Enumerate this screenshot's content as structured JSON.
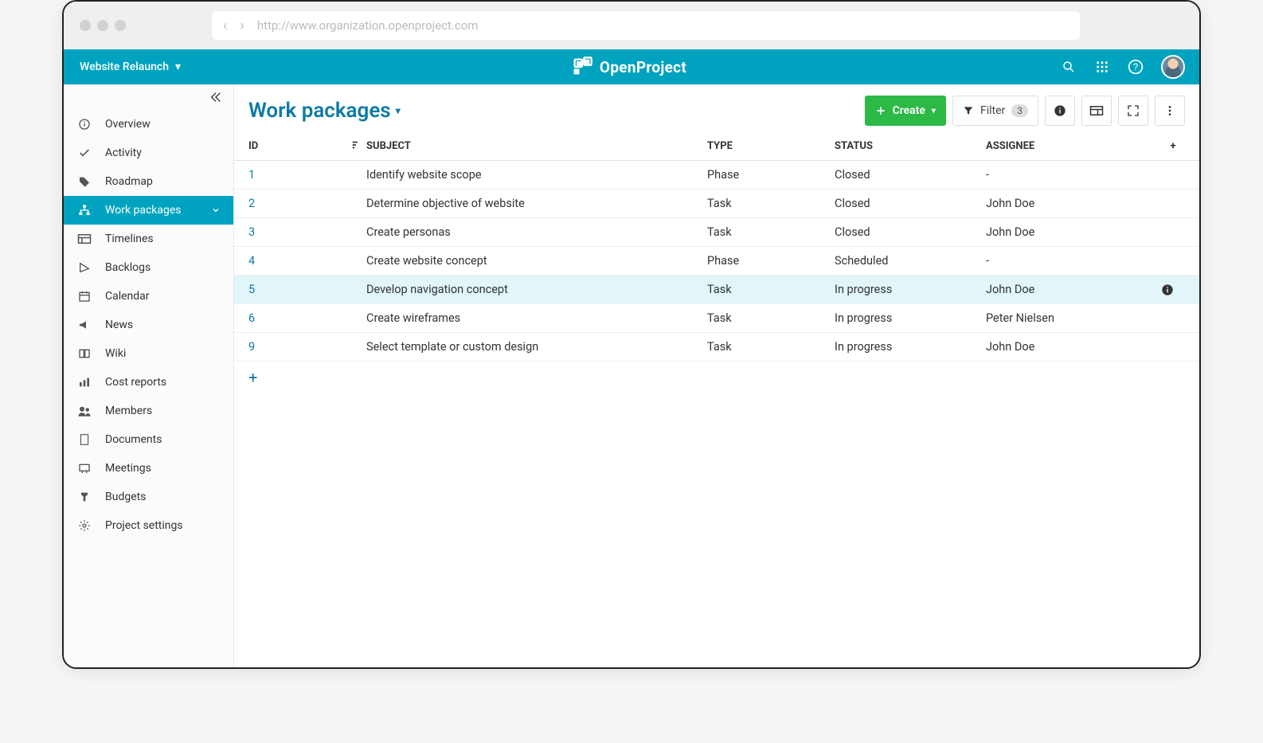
{
  "browser": {
    "url": "http://www.organization.openproject.com"
  },
  "project": {
    "name": "Website Relaunch"
  },
  "brand": {
    "name": "OpenProject"
  },
  "sidebar": {
    "items": [
      {
        "label": "Overview",
        "icon": "info-icon"
      },
      {
        "label": "Activity",
        "icon": "check-icon"
      },
      {
        "label": "Roadmap",
        "icon": "tag-icon"
      },
      {
        "label": "Work packages",
        "icon": "sitemap-icon",
        "active": true,
        "expandable": true
      },
      {
        "label": "Timelines",
        "icon": "timeline-icon"
      },
      {
        "label": "Backlogs",
        "icon": "backlog-icon"
      },
      {
        "label": "Calendar",
        "icon": "calendar-icon"
      },
      {
        "label": "News",
        "icon": "megaphone-icon"
      },
      {
        "label": "Wiki",
        "icon": "book-icon"
      },
      {
        "label": "Cost reports",
        "icon": "chart-icon"
      },
      {
        "label": "Members",
        "icon": "members-icon"
      },
      {
        "label": "Documents",
        "icon": "document-icon"
      },
      {
        "label": "Meetings",
        "icon": "meeting-icon"
      },
      {
        "label": "Budgets",
        "icon": "budget-icon"
      },
      {
        "label": "Project settings",
        "icon": "gear-icon"
      }
    ]
  },
  "page": {
    "title": "Work packages"
  },
  "toolbar": {
    "create": "Create",
    "filter": "Filter",
    "filter_count": "3"
  },
  "table": {
    "headers": {
      "id": "ID",
      "subject": "SUBJECT",
      "type": "TYPE",
      "status": "STATUS",
      "assignee": "ASSIGNEE"
    },
    "rows": [
      {
        "id": "1",
        "subject": "Identify website scope",
        "type": "Phase",
        "status": "Closed",
        "assignee": "-"
      },
      {
        "id": "2",
        "subject": "Determine objective of website",
        "type": "Task",
        "status": "Closed",
        "assignee": "John Doe"
      },
      {
        "id": "3",
        "subject": "Create personas",
        "type": "Task",
        "status": "Closed",
        "assignee": "John Doe"
      },
      {
        "id": "4",
        "subject": "Create website concept",
        "type": "Phase",
        "status": "Scheduled",
        "assignee": "-"
      },
      {
        "id": "5",
        "subject": "Develop navigation concept",
        "type": "Task",
        "status": "In progress",
        "assignee": "John Doe",
        "highlighted": true,
        "info": true
      },
      {
        "id": "6",
        "subject": "Create wireframes",
        "type": "Task",
        "status": "In progress",
        "assignee": "Peter Nielsen"
      },
      {
        "id": "9",
        "subject": "Select template or custom design",
        "type": "Task",
        "status": "In progress",
        "assignee": "John Doe"
      }
    ]
  }
}
